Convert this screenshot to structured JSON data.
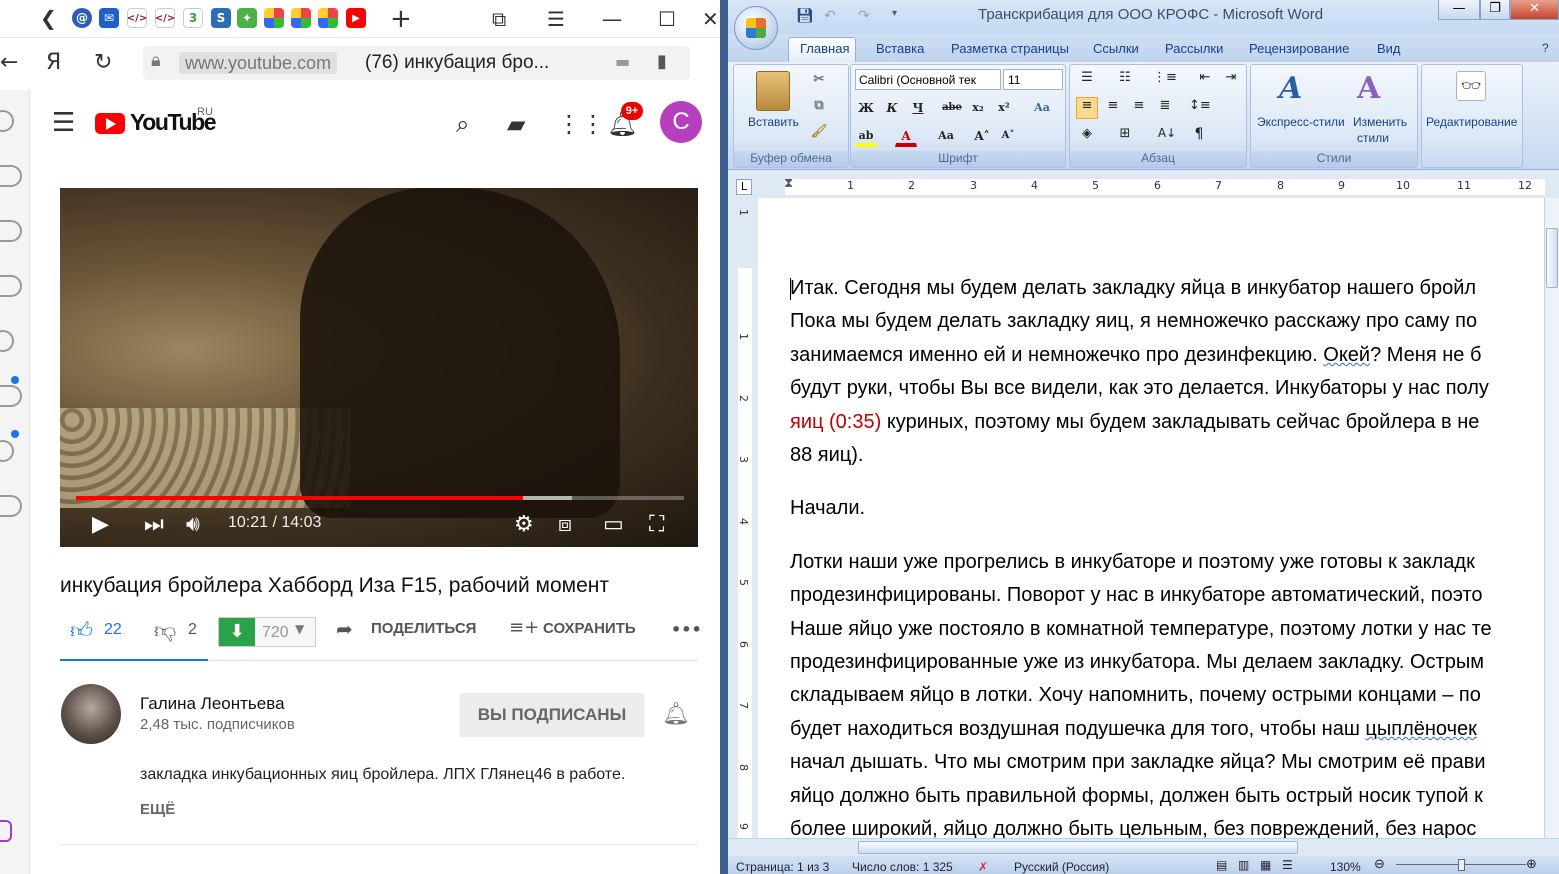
{
  "browser": {
    "url_host": "www.youtube.com",
    "url_title": "(76) инкубация бро...",
    "yandex_label": "Я",
    "badge_top": "9+"
  },
  "youtube": {
    "logo_text": "YouTube",
    "logo_region": "RU",
    "avatar_letter": "C",
    "notifications": "9+",
    "player": {
      "time": "10:21 / 14:03",
      "progress_fraction": 0.735,
      "buffered_fraction": 0.815
    },
    "video_title": "инкубация бройлера Хабборд Иза F15, рабочий момент",
    "likes": "22",
    "dislikes": "2",
    "download_count": "720",
    "share_label": "ПОДЕЛИТЬСЯ",
    "save_label": "СОХРАНИТЬ",
    "more_label": "•••",
    "channel": {
      "name": "Галина Леонтьева",
      "subscribers": "2,48 тыс. подписчиков",
      "subscribed_label": "ВЫ ПОДПИСАНЫ"
    },
    "description": "закладка инкубационных яиц бройлера. ЛПХ ГЛянец46 в работе.",
    "more_link": "ЕЩЁ"
  },
  "word": {
    "title": "Транскрибация для ООО КРОФС - Microsoft Word",
    "tabs": [
      "Главная",
      "Вставка",
      "Разметка страницы",
      "Ссылки",
      "Рассылки",
      "Рецензирование",
      "Вид"
    ],
    "ribbon": {
      "paste_label": "Вставить",
      "clipboard_group": "Буфер обмена",
      "font_group": "Шрифт",
      "paragraph_group": "Абзац",
      "styles_group": "Стили",
      "font_name": "Calibri (Основной тек",
      "font_size": "11",
      "express_styles": "Экспресс-стили",
      "change_styles_1": "Изменить",
      "change_styles_2": "стили",
      "editing": "Редактирование"
    },
    "ruler_h": [
      "1",
      "2",
      "3",
      "4",
      "5",
      "6",
      "7",
      "8",
      "9",
      "10",
      "11",
      "12"
    ],
    "ruler_v": [
      "1",
      "1",
      "2",
      "3",
      "4",
      "5",
      "6",
      "7",
      "8",
      "9"
    ],
    "document": {
      "p1_l1": "Итак. Сегодня мы будем делать закладку яйца  в инкубатор нашего бройл",
      "p1_l2": "Пока мы будем делать закладку яиц, я немножечко расскажу про саму по",
      "p1_l3a": "занимаемся именно ей и немножечко про дезинфекцию. ",
      "p1_l3b": "Окей",
      "p1_l3c": "? Меня не б",
      "p1_l4": "будут руки, чтобы Вы все видели, как это делается. Инкубаторы у нас полу",
      "p1_l5a": "яиц (0:35)",
      "p1_l5b": "  куриных,  поэтому мы будем закладывать сейчас бройлера в не",
      "p1_l6": "88 яиц).",
      "p2": "Начали.",
      "p3_l1": "Лотки наши уже прогрелись в инкубаторе и поэтому уже готовы к закладк",
      "p3_l2": "продезинфицированы. Поворот у нас в инкубаторе автоматический, поэто",
      "p3_l3": "Наше яйцо уже постояло в комнатной температуре, поэтому лотки у нас те",
      "p3_l4": "продезинфицированные уже из инкубатора. Мы делаем закладку. Острым",
      "p3_l5": "складываем яйцо в лотки. Хочу напомнить, почему острыми концами – по",
      "p3_l6a": "будет находиться воздушная подушечка для того, чтобы наш ",
      "p3_l6b": "цыплёночек",
      "p3_l7": "начал дышать. Что мы смотрим при закладке яйца? Мы смотрим её прави",
      "p3_l8": "яйцо должно быть правильной формы, должен быть острый носик тупой к",
      "p3_l9": "более широкий, яйцо должно быть цельным, без повреждений, без нарос"
    },
    "status": {
      "page": "Страница: 1 из 3",
      "words": "Число слов: 1 325",
      "language": "Русский (Россия)",
      "zoom": "130%"
    }
  }
}
